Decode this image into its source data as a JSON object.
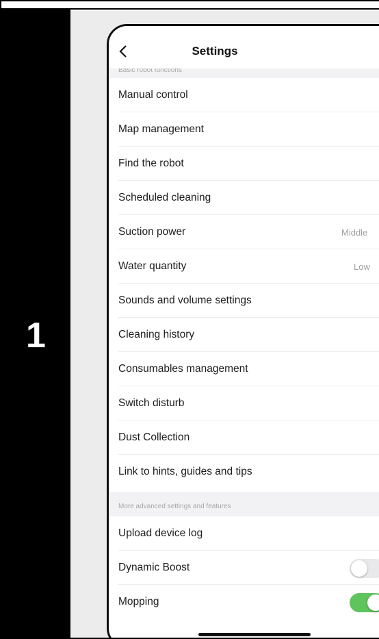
{
  "step": {
    "number": "1"
  },
  "nav": {
    "title": "Settings",
    "back_icon": "chevron-left-icon"
  },
  "sections": {
    "basic": {
      "header": "Basic robot functions"
    },
    "advanced": {
      "header": "More advanced settings and features"
    }
  },
  "items": [
    {
      "label": "Manual control"
    },
    {
      "label": "Map management"
    },
    {
      "label": "Find the robot"
    },
    {
      "label": "Scheduled cleaning"
    },
    {
      "label": "Suction power",
      "value": "Middle"
    },
    {
      "label": "Water quantity",
      "value": "Low"
    },
    {
      "label": "Sounds and volume settings"
    },
    {
      "label": "Cleaning history"
    },
    {
      "label": "Consumables management"
    },
    {
      "label": "Switch disturb"
    },
    {
      "label": "Dust Collection"
    },
    {
      "label": "Link to hints, guides and tips"
    }
  ],
  "advanced_items": [
    {
      "label": "Upload device log"
    },
    {
      "label": "Dynamic Boost",
      "toggle": "off"
    },
    {
      "label": "Mopping",
      "toggle": "on"
    }
  ],
  "colors": {
    "toggle_on": "#5fc45c",
    "toggle_off": "#e9e9eb",
    "step_bg": "#000000"
  }
}
